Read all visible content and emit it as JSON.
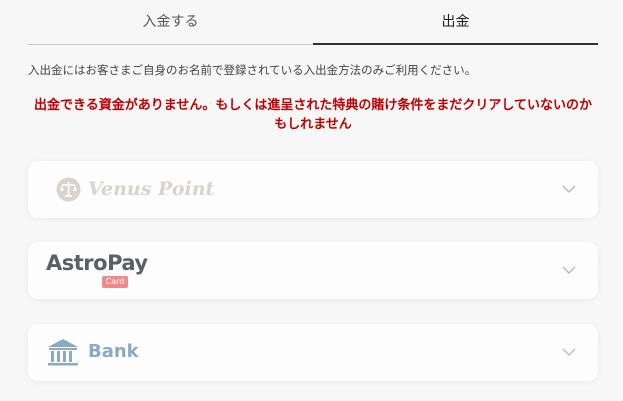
{
  "tabs": [
    {
      "label": "入金する",
      "active": false
    },
    {
      "label": "出金",
      "active": true
    }
  ],
  "note": "入出金にはお客さまご自身のお名前で登録されている入出金方法のみご利用ください。",
  "warning": "出金できる資金がありません。もしくは進呈された特典の賭け条件をまだクリアしていないのかもしれません",
  "methods": [
    {
      "name": "Venus Point",
      "icon": "scales-icon",
      "disabled": true
    },
    {
      "name": "AstroPay",
      "badge": "Card"
    },
    {
      "name": "Bank",
      "icon": "bank-building-icon"
    }
  ],
  "colors": {
    "warning": "#c00000",
    "background": "#f7f7f7",
    "card": "#fdfdfd"
  }
}
